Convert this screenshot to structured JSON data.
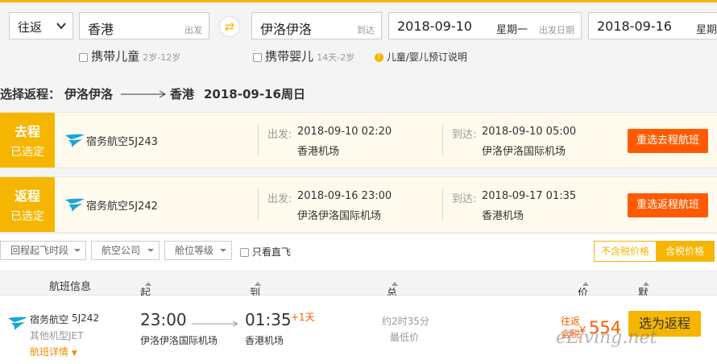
{
  "search": {
    "trip_type": "往返",
    "from_city": "香港",
    "from_tag": "出发",
    "to_city": "伊洛伊洛",
    "to_tag": "到达",
    "depart_date": "2018-09-10",
    "depart_weekday": "星期一",
    "depart_tag": "出发日期",
    "return_date": "2018-09-16",
    "return_weekday": "星期",
    "child_label": "携带儿童",
    "child_age": "2岁-12岁",
    "infant_label": "携带婴儿",
    "infant_age": "14天-2岁",
    "notice_link": "儿童/婴儿预订说明"
  },
  "heading": {
    "prefix": "选择返程：",
    "origin": "伊洛伊洛",
    "dest": "香港",
    "date": "2018-09-16周日"
  },
  "selected": [
    {
      "side_top": "去程",
      "side_bottom": "已选定",
      "airline": "宿务航空5J243",
      "dep_label": "出发:",
      "dep_time": "2018-09-10 02:20",
      "dep_airport": "香港机场",
      "arr_label": "到达:",
      "arr_time": "2018-09-10 05:00",
      "arr_airport": "伊洛伊洛国际机场",
      "button": "重选去程航班"
    },
    {
      "side_top": "返程",
      "side_bottom": "已选定",
      "airline": "宿务航空5J242",
      "dep_label": "出发:",
      "dep_time": "2018-09-16 23:00",
      "dep_airport": "伊洛伊洛国际机场",
      "arr_label": "到达:",
      "arr_time": "2018-09-17 01:35",
      "arr_airport": "香港机场",
      "button": "重选返程航班"
    }
  ],
  "filters": {
    "dep_time": "回程起飞时段",
    "airline": "航空公司",
    "cabin": "舱位等级",
    "direct_only": "只看直飞",
    "no_tax": "不含税价格",
    "with_tax": "含税价格"
  },
  "columns": {
    "flight_info": "航班信息",
    "dep_time": "起飞时间",
    "arr_time": "到达时间",
    "duration": "总耗时",
    "price": "价格",
    "sort": "默认排序"
  },
  "flight": {
    "airline": "宿务航空",
    "number": "5J242",
    "aircraft": "其他机型JET",
    "details_link": "航班详情",
    "dep_time": "23:00",
    "dep_airport": "伊洛伊洛国际机场",
    "arr_time": "01:35",
    "arr_plus": "+1天",
    "arr_airport": "香港机场",
    "duration": "约2时35分",
    "duration_note": "最低价",
    "price_type": "往返",
    "price_tax": "含税",
    "currency": "¥",
    "price": "554",
    "select_button": "选为返程"
  },
  "watermark": "eLiving.net",
  "colors": {
    "accent": "#f6b500",
    "action": "#ff5a00",
    "price": "#ff5a00"
  }
}
